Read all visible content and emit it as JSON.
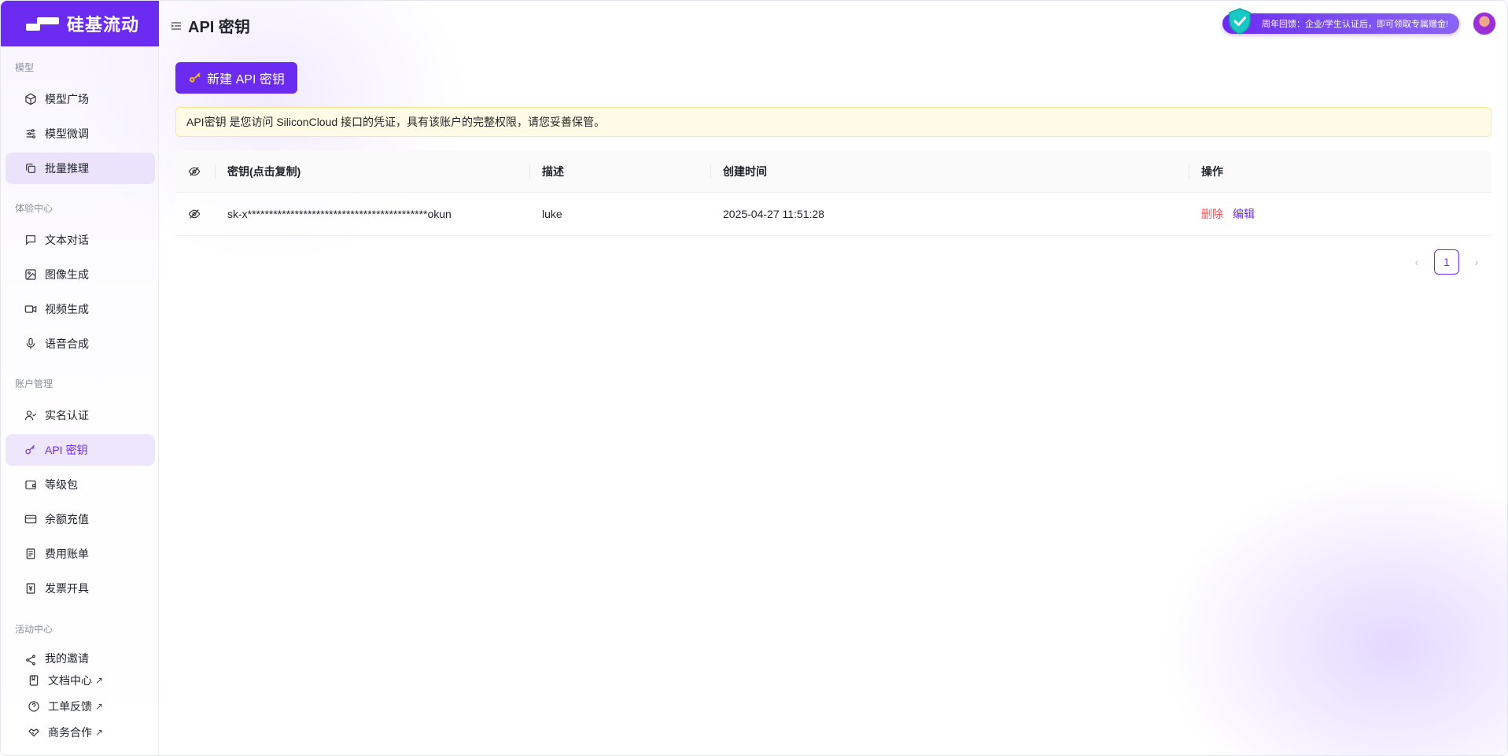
{
  "app": {
    "name": "硅基流动"
  },
  "header": {
    "title": "API 密钥"
  },
  "promo": {
    "text": "周年回馈：企业/学生认证后，即可领取专属赠金!"
  },
  "sidebar": {
    "sections": [
      {
        "label": "模型"
      },
      {
        "label": "体验中心"
      },
      {
        "label": "账户管理"
      },
      {
        "label": "活动中心"
      }
    ],
    "items": [
      {
        "label": "模型广场",
        "icon": "cube-icon"
      },
      {
        "label": "模型微调",
        "icon": "sliders-icon"
      },
      {
        "label": "批量推理",
        "icon": "copy-icon"
      },
      {
        "label": "文本对话",
        "icon": "chat-icon"
      },
      {
        "label": "图像生成",
        "icon": "image-icon"
      },
      {
        "label": "视频生成",
        "icon": "video-icon"
      },
      {
        "label": "语音合成",
        "icon": "mic-icon"
      },
      {
        "label": "实名认证",
        "icon": "user-check-icon"
      },
      {
        "label": "API 密钥",
        "icon": "key-icon"
      },
      {
        "label": "等级包",
        "icon": "wallet-icon"
      },
      {
        "label": "余额充值",
        "icon": "card-icon"
      },
      {
        "label": "费用账单",
        "icon": "receipt-icon"
      },
      {
        "label": "发票开具",
        "icon": "invoice-icon"
      },
      {
        "label": "我的邀请",
        "icon": "share-icon"
      }
    ],
    "footer_links": [
      {
        "label": "文档中心",
        "icon": "book-icon"
      },
      {
        "label": "工单反馈",
        "icon": "help-icon"
      },
      {
        "label": "商务合作",
        "icon": "handshake-icon"
      }
    ],
    "external_mark": "↗"
  },
  "actions": {
    "new_key_label": "新建 API 密钥"
  },
  "notice": {
    "text": "API密钥 是您访问 SiliconCloud 接口的凭证，具有该账户的完整权限，请您妥善保管。"
  },
  "table": {
    "columns": [
      "密钥(点击复制)",
      "描述",
      "创建时间",
      "操作"
    ],
    "rows": [
      {
        "key": "sk-x******************************************okun",
        "description": "luke",
        "created": "2025-04-27 11:51:28",
        "delete_label": "删除",
        "edit_label": "编辑"
      }
    ]
  },
  "pagination": {
    "current": "1",
    "prev": "‹",
    "next": "›"
  },
  "colors": {
    "brand": "#6c2bf0",
    "danger": "#ff4d4f",
    "notice_bg": "#fffbe6"
  }
}
